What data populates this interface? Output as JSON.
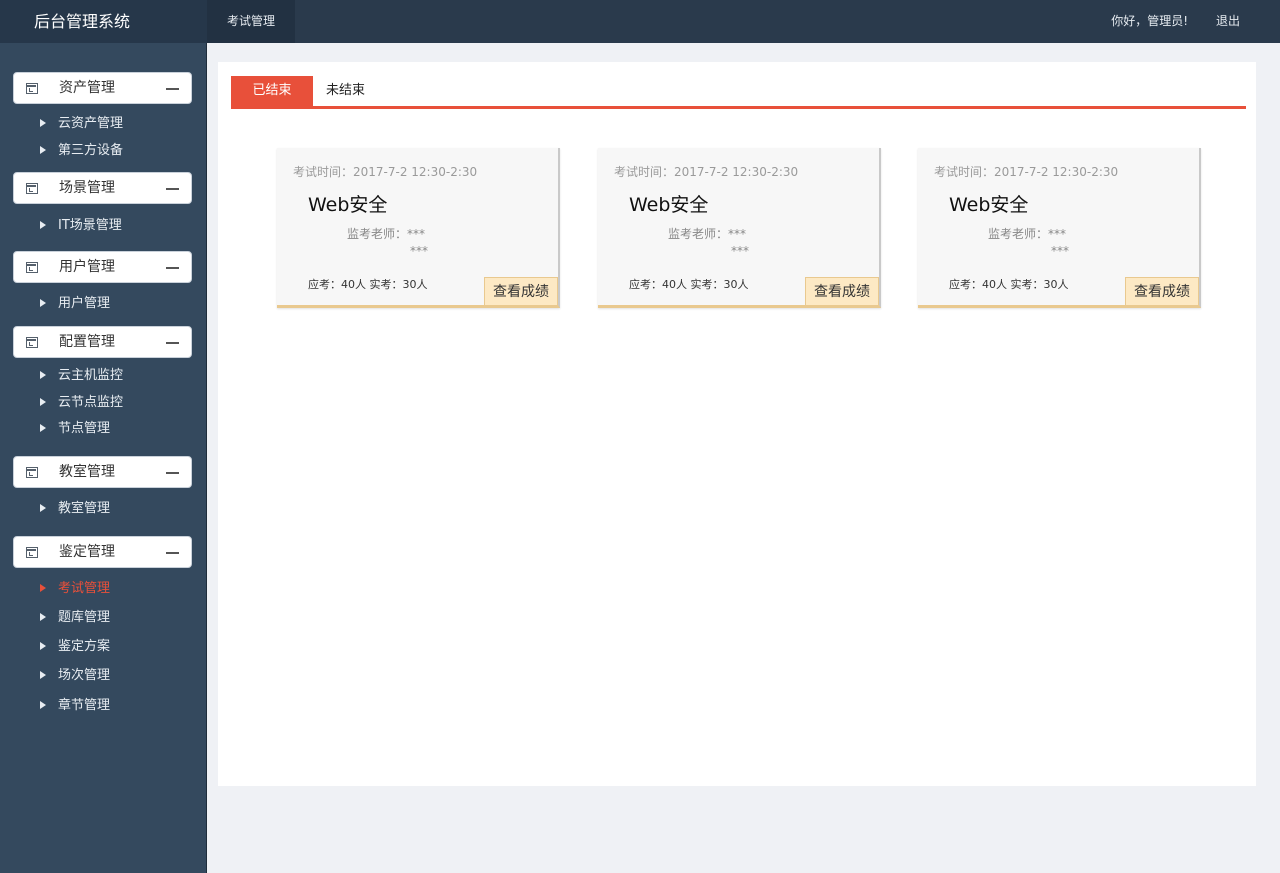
{
  "app": {
    "title": "后台管理系统",
    "top_tab": "考试管理",
    "greeting": "你好，管理员!",
    "logout": "退出"
  },
  "sidebar": {
    "groups": [
      {
        "label": "资产管理",
        "items": [
          "云资产管理",
          "第三方设备"
        ]
      },
      {
        "label": "场景管理",
        "items": [
          "IT场景管理"
        ]
      },
      {
        "label": "用户管理",
        "items": [
          "用户管理"
        ]
      },
      {
        "label": "配置管理",
        "items": [
          "云主机监控",
          "云节点监控",
          "节点管理"
        ]
      },
      {
        "label": "教室管理",
        "items": [
          "教室管理"
        ]
      },
      {
        "label": "鉴定管理",
        "items": [
          "考试管理",
          "题库管理",
          "鉴定方案",
          "场次管理",
          "章节管理"
        ]
      }
    ],
    "active_item": "考试管理"
  },
  "tabs": {
    "done": "已结束",
    "undone": "未结束"
  },
  "cards": [
    {
      "time": "考试时间：2017-7-2 12:30-2:30",
      "title": "Web安全",
      "proctor": "监考老师：***",
      "proctor2": "***",
      "counts": "应考：40人  实考：30人",
      "button": "查看成绩"
    },
    {
      "time": "考试时间：2017-7-2 12:30-2:30",
      "title": "Web安全",
      "proctor": "监考老师：***",
      "proctor2": "***",
      "counts": "应考：40人  实考：30人",
      "button": "查看成绩"
    },
    {
      "time": "考试时间：2017-7-2 12:30-2:30",
      "title": "Web安全",
      "proctor": "监考老师：***",
      "proctor2": "***",
      "counts": "应考：40人  实考：30人",
      "button": "查看成绩"
    }
  ],
  "colors": {
    "accent": "#e8503a",
    "sidebar": "#34495e",
    "topbar": "#2a3a4c",
    "button_bg": "#fde9c4"
  }
}
